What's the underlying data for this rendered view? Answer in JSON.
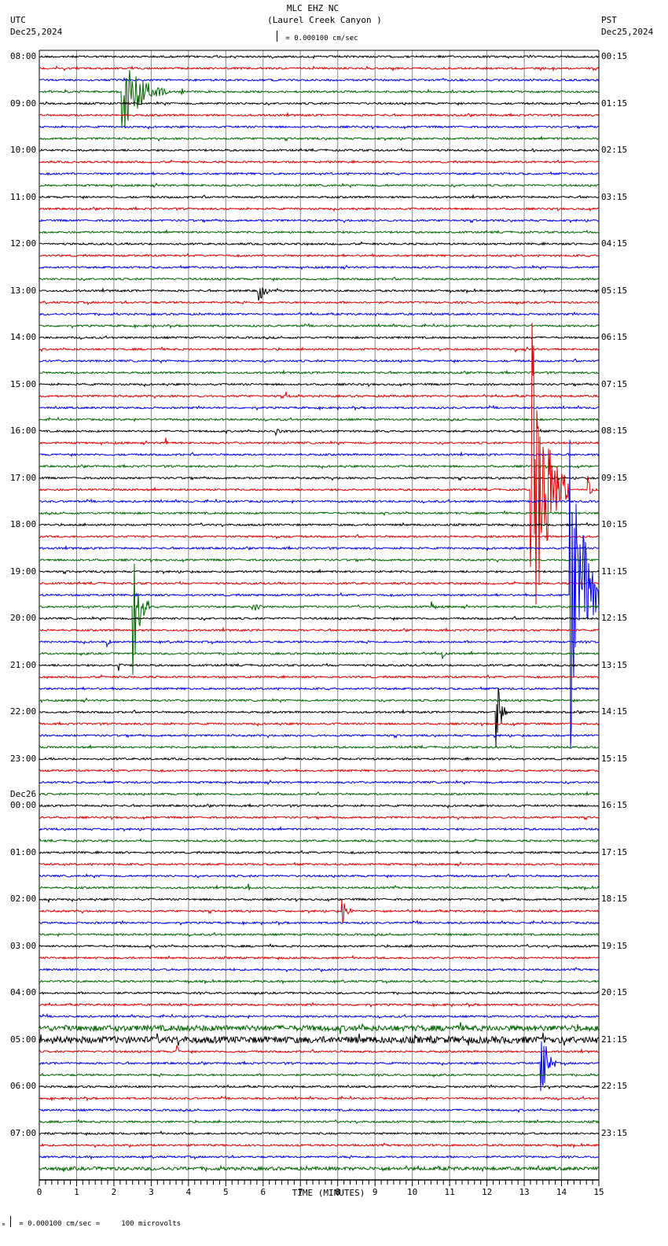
{
  "header": {
    "station": "MLC EHZ NC",
    "location": "(Laurel Creek Canyon )",
    "left_tz": "UTC",
    "left_date": "Dec25,2024",
    "right_tz": "PST",
    "right_date": "Dec25,2024",
    "scale": "= 0.000100 cm/sec"
  },
  "footer": {
    "scale": "= 0.000100 cm/sec =     100 microvolts",
    "mark": "ₘ"
  },
  "chart_data": {
    "type": "line",
    "title": "MLC EHZ NC (Laurel Creek Canyon )",
    "xlabel": "TIME (MINUTES)",
    "xlim": [
      0,
      15
    ],
    "x_ticks": [
      "0",
      "1",
      "2",
      "3",
      "4",
      "5",
      "6",
      "7",
      "8",
      "9",
      "10",
      "11",
      "12",
      "13",
      "14",
      "15"
    ],
    "trace_count": 96,
    "trace_minutes": 15,
    "colors": [
      "#000000",
      "#dd0000",
      "#0000ee",
      "#006600"
    ],
    "left_labels": [
      {
        "trace": 0,
        "text": "08:00"
      },
      {
        "trace": 4,
        "text": "09:00"
      },
      {
        "trace": 8,
        "text": "10:00"
      },
      {
        "trace": 12,
        "text": "11:00"
      },
      {
        "trace": 16,
        "text": "12:00"
      },
      {
        "trace": 20,
        "text": "13:00"
      },
      {
        "trace": 24,
        "text": "14:00"
      },
      {
        "trace": 28,
        "text": "15:00"
      },
      {
        "trace": 32,
        "text": "16:00"
      },
      {
        "trace": 36,
        "text": "17:00"
      },
      {
        "trace": 40,
        "text": "18:00"
      },
      {
        "trace": 44,
        "text": "19:00"
      },
      {
        "trace": 48,
        "text": "20:00"
      },
      {
        "trace": 52,
        "text": "21:00"
      },
      {
        "trace": 56,
        "text": "22:00"
      },
      {
        "trace": 60,
        "text": "23:00"
      },
      {
        "trace": 64,
        "text": "00:00",
        "date": "Dec26"
      },
      {
        "trace": 68,
        "text": "01:00"
      },
      {
        "trace": 72,
        "text": "02:00"
      },
      {
        "trace": 76,
        "text": "03:00"
      },
      {
        "trace": 80,
        "text": "04:00"
      },
      {
        "trace": 84,
        "text": "05:00"
      },
      {
        "trace": 88,
        "text": "06:00"
      },
      {
        "trace": 92,
        "text": "07:00"
      }
    ],
    "right_labels": [
      "00:15",
      "01:15",
      "02:15",
      "03:15",
      "04:15",
      "05:15",
      "06:15",
      "07:15",
      "08:15",
      "09:15",
      "10:15",
      "11:15",
      "12:15",
      "13:15",
      "14:15",
      "15:15",
      "16:15",
      "17:15",
      "18:15",
      "19:15",
      "20:15",
      "21:15",
      "22:15",
      "23:15"
    ],
    "noisy_traces": [
      {
        "trace": 83,
        "level": 3
      },
      {
        "trace": 84,
        "level": 3.5
      },
      {
        "trace": 95,
        "level": 1.8
      }
    ],
    "events": [
      {
        "trace": 3,
        "minute": 2.2,
        "amplitude": 60,
        "coda": 1.2
      },
      {
        "trace": 3,
        "minute": 3.8,
        "amplitude": 9,
        "coda": 0.1
      },
      {
        "trace": 8,
        "minute": 13.2,
        "amplitude": 6,
        "coda": 0.2
      },
      {
        "trace": 20,
        "minute": 5.85,
        "amplitude": 22,
        "coda": 0.3
      },
      {
        "trace": 25,
        "minute": 12.75,
        "amplitude": 7,
        "coda": 0.1
      },
      {
        "trace": 29,
        "minute": 6.6,
        "amplitude": 6,
        "coda": 0.1
      },
      {
        "trace": 33,
        "minute": 3.35,
        "amplitude": 22,
        "coda": 0.05
      },
      {
        "trace": 32,
        "minute": 6.3,
        "amplitude": 6,
        "coda": 0.4
      },
      {
        "trace": 37,
        "minute": 13.15,
        "amplitude": 250,
        "coda": 1.0
      },
      {
        "trace": 37,
        "minute": 14.7,
        "amplitude": 30,
        "coda": 0.1
      },
      {
        "trace": 41,
        "minute": 6.35,
        "amplitude": 6,
        "coda": 0.1
      },
      {
        "trace": 46,
        "minute": 14.2,
        "amplitude": 230,
        "coda": 1.0
      },
      {
        "trace": 47,
        "minute": 2.5,
        "amplitude": 100,
        "coda": 0.4
      },
      {
        "trace": 47,
        "minute": 5.7,
        "amplitude": 12,
        "coda": 0.3
      },
      {
        "trace": 47,
        "minute": 10.5,
        "amplitude": 10,
        "coda": 0.1
      },
      {
        "trace": 50,
        "minute": 1.8,
        "amplitude": 14,
        "coda": 0.1
      },
      {
        "trace": 52,
        "minute": 2.1,
        "amplitude": 14,
        "coda": 0.2
      },
      {
        "trace": 51,
        "minute": 10.8,
        "amplitude": 12,
        "coda": 0.1
      },
      {
        "trace": 56,
        "minute": 12.2,
        "amplitude": 70,
        "coda": 0.3
      },
      {
        "trace": 71,
        "minute": 5.6,
        "amplitude": 6,
        "coda": 0.1
      },
      {
        "trace": 72,
        "minute": 0.2,
        "amplitude": 8,
        "coda": 0.1
      },
      {
        "trace": 73,
        "minute": 8.1,
        "amplitude": 22,
        "coda": 0.3
      },
      {
        "trace": 84,
        "minute": 13.6,
        "amplitude": 20,
        "coda": 0.05
      },
      {
        "trace": 85,
        "minute": 3.65,
        "amplitude": 40,
        "coda": 0.05
      },
      {
        "trace": 86,
        "minute": 13.4,
        "amplitude": 70,
        "coda": 0.4
      }
    ]
  }
}
